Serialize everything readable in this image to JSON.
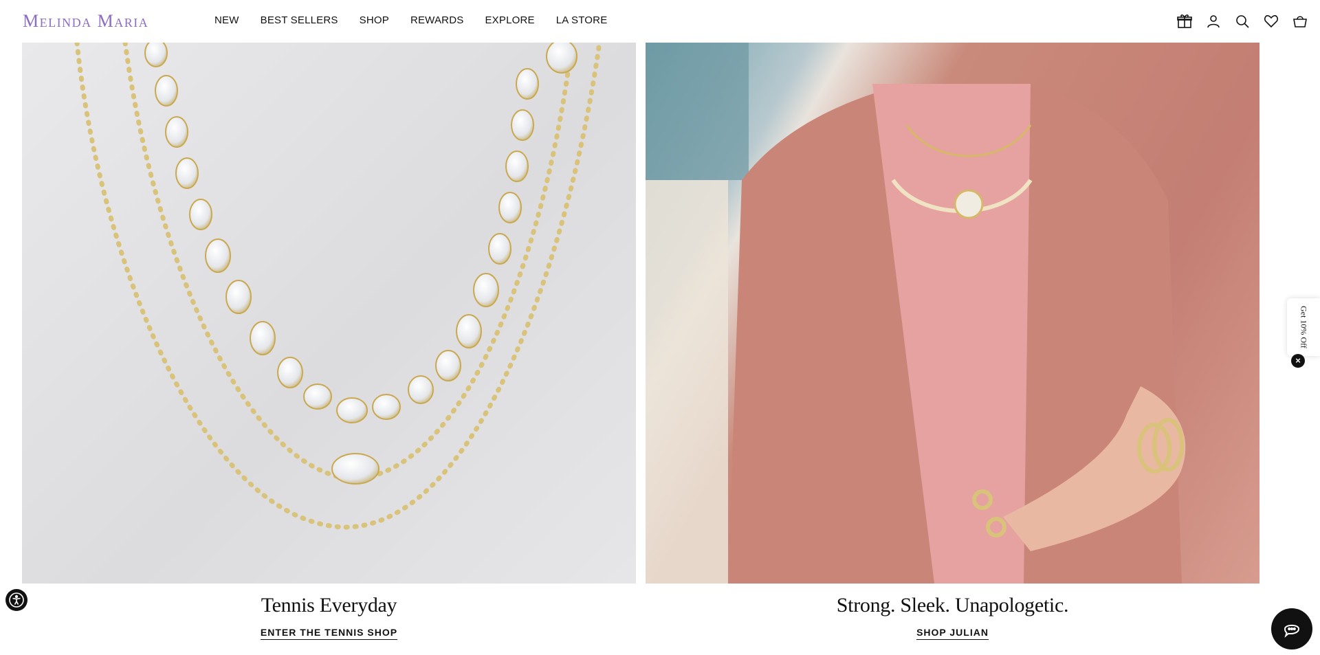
{
  "brand": {
    "logo_text": "Melinda Maria",
    "logo_color": "#8c6cc4"
  },
  "nav": {
    "items": [
      {
        "label": "NEW"
      },
      {
        "label": "BEST SELLERS"
      },
      {
        "label": "SHOP"
      },
      {
        "label": "REWARDS"
      },
      {
        "label": "EXPLORE"
      },
      {
        "label": "LA STORE"
      }
    ]
  },
  "header_icons": [
    "gift-icon",
    "account-icon",
    "search-icon",
    "wishlist-heart-icon",
    "cart-basket-icon"
  ],
  "features": [
    {
      "title": "Tennis Everyday",
      "cta": "ENTER THE TENNIS SHOP"
    },
    {
      "title": "Strong. Sleek. Unapologetic.",
      "cta": "SHOP JULIAN"
    }
  ],
  "discount_tab": {
    "label": "Get 10% Off",
    "close": "×"
  },
  "widgets": {
    "accessibility": "accessibility-icon",
    "chat": "chat-bubble-icon"
  }
}
